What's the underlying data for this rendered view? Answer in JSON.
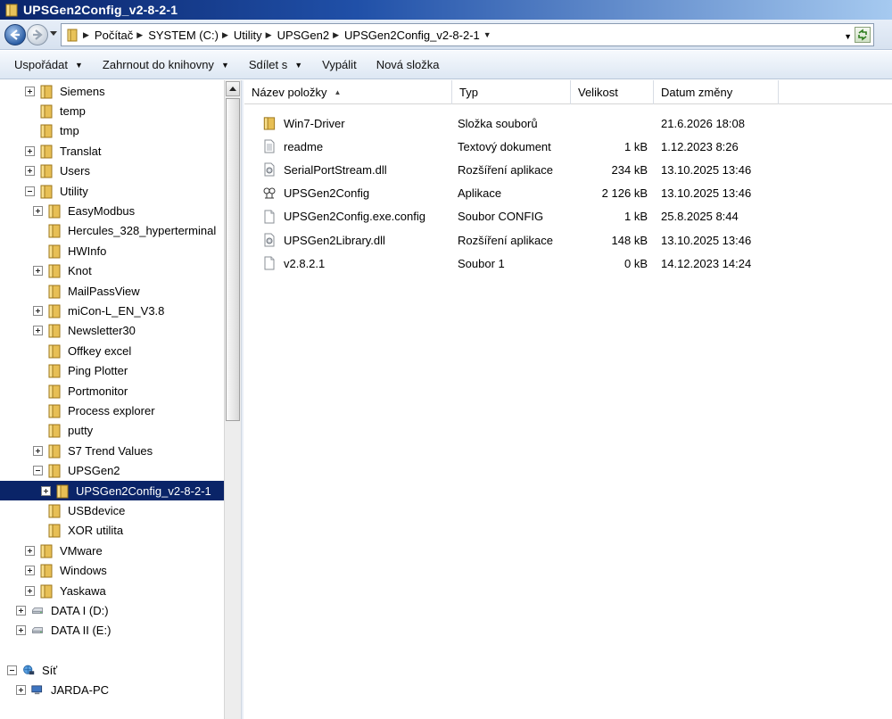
{
  "window": {
    "title": "UPSGen2Config_v2-8-2-1"
  },
  "address": {
    "crumbs": [
      "Počítač",
      "SYSTEM (C:)",
      "Utility",
      "UPSGen2",
      "UPSGen2Config_v2-8-2-1"
    ]
  },
  "toolbar": {
    "organize": "Uspořádat",
    "include_library": "Zahrnout do knihovny",
    "share": "Sdílet s",
    "burn": "Vypálit",
    "new_folder": "Nová složka"
  },
  "tree": [
    {
      "label": "Siemens",
      "level": 1,
      "expander": "plus",
      "icon": "folder-icon"
    },
    {
      "label": "temp",
      "level": 1,
      "expander": "none",
      "icon": "folder-icon"
    },
    {
      "label": "tmp",
      "level": 1,
      "expander": "none",
      "icon": "folder-icon"
    },
    {
      "label": "Translat",
      "level": 1,
      "expander": "plus",
      "icon": "folder-icon"
    },
    {
      "label": "Users",
      "level": 1,
      "expander": "plus",
      "icon": "folder-icon"
    },
    {
      "label": "Utility",
      "level": 1,
      "expander": "minus",
      "icon": "folder-icon"
    },
    {
      "label": "EasyModbus",
      "level": 2,
      "expander": "plus",
      "icon": "folder-icon"
    },
    {
      "label": "Hercules_328_hyperterminal",
      "level": 2,
      "expander": "none",
      "icon": "folder-icon"
    },
    {
      "label": "HWInfo",
      "level": 2,
      "expander": "none",
      "icon": "folder-icon"
    },
    {
      "label": "Knot",
      "level": 2,
      "expander": "plus",
      "icon": "folder-icon"
    },
    {
      "label": "MailPassView",
      "level": 2,
      "expander": "none",
      "icon": "folder-icon"
    },
    {
      "label": "miCon-L_EN_V3.8",
      "level": 2,
      "expander": "plus",
      "icon": "folder-icon"
    },
    {
      "label": "Newsletter30",
      "level": 2,
      "expander": "plus",
      "icon": "folder-icon"
    },
    {
      "label": "Offkey excel",
      "level": 2,
      "expander": "none",
      "icon": "folder-icon"
    },
    {
      "label": "Ping Plotter",
      "level": 2,
      "expander": "none",
      "icon": "folder-icon"
    },
    {
      "label": "Portmonitor",
      "level": 2,
      "expander": "none",
      "icon": "folder-icon"
    },
    {
      "label": "Process explorer",
      "level": 2,
      "expander": "none",
      "icon": "folder-icon"
    },
    {
      "label": "putty",
      "level": 2,
      "expander": "none",
      "icon": "folder-icon"
    },
    {
      "label": "S7 Trend Values",
      "level": 2,
      "expander": "plus",
      "icon": "folder-icon"
    },
    {
      "label": "UPSGen2",
      "level": 2,
      "expander": "minus",
      "icon": "folder-icon"
    },
    {
      "label": "UPSGen2Config_v2-8-2-1",
      "level": 3,
      "expander": "plus",
      "icon": "folder-icon",
      "selected": true
    },
    {
      "label": "USBdevice",
      "level": 2,
      "expander": "none",
      "icon": "folder-icon"
    },
    {
      "label": "XOR utilita",
      "level": 2,
      "expander": "none",
      "icon": "folder-icon"
    },
    {
      "label": "VMware",
      "level": 1,
      "expander": "plus",
      "icon": "folder-icon"
    },
    {
      "label": "Windows",
      "level": 1,
      "expander": "plus",
      "icon": "folder-icon"
    },
    {
      "label": "Yaskawa",
      "level": 1,
      "expander": "plus",
      "icon": "folder-icon"
    },
    {
      "label": "DATA I (D:)",
      "level": 0,
      "expander": "plus",
      "icon": "drive-icon"
    },
    {
      "label": "DATA II (E:)",
      "level": 0,
      "expander": "plus",
      "icon": "drive-icon"
    },
    {
      "label": "Síť",
      "level": -1,
      "expander": "minus",
      "icon": "network-icon",
      "gap": true
    },
    {
      "label": "JARDA-PC",
      "level": 0,
      "expander": "plus",
      "icon": "computer-icon"
    }
  ],
  "columns": {
    "name": "Název položky",
    "type": "Typ",
    "size": "Velikost",
    "date": "Datum změny"
  },
  "files": [
    {
      "name": "Win7-Driver",
      "type": "Složka souborů",
      "size": "",
      "date": "21.6.2026 18:08",
      "icon": "folder-icon"
    },
    {
      "name": "readme",
      "type": "Textový dokument",
      "size": "1 kB",
      "date": "1.12.2023 8:26",
      "icon": "text-file-icon"
    },
    {
      "name": "SerialPortStream.dll",
      "type": "Rozšíření aplikace",
      "size": "234 kB",
      "date": "13.10.2025 13:46",
      "icon": "dll-file-icon"
    },
    {
      "name": "UPSGen2Config",
      "type": "Aplikace",
      "size": "2 126 kB",
      "date": "13.10.2025 13:46",
      "icon": "app-icon"
    },
    {
      "name": "UPSGen2Config.exe.config",
      "type": "Soubor CONFIG",
      "size": "1 kB",
      "date": "25.8.2025 8:44",
      "icon": "file-icon"
    },
    {
      "name": "UPSGen2Library.dll",
      "type": "Rozšíření aplikace",
      "size": "148 kB",
      "date": "13.10.2025 13:46",
      "icon": "dll-file-icon"
    },
    {
      "name": "v2.8.2.1",
      "type": "Soubor 1",
      "size": "0 kB",
      "date": "14.12.2023 14:24",
      "icon": "file-icon"
    }
  ]
}
